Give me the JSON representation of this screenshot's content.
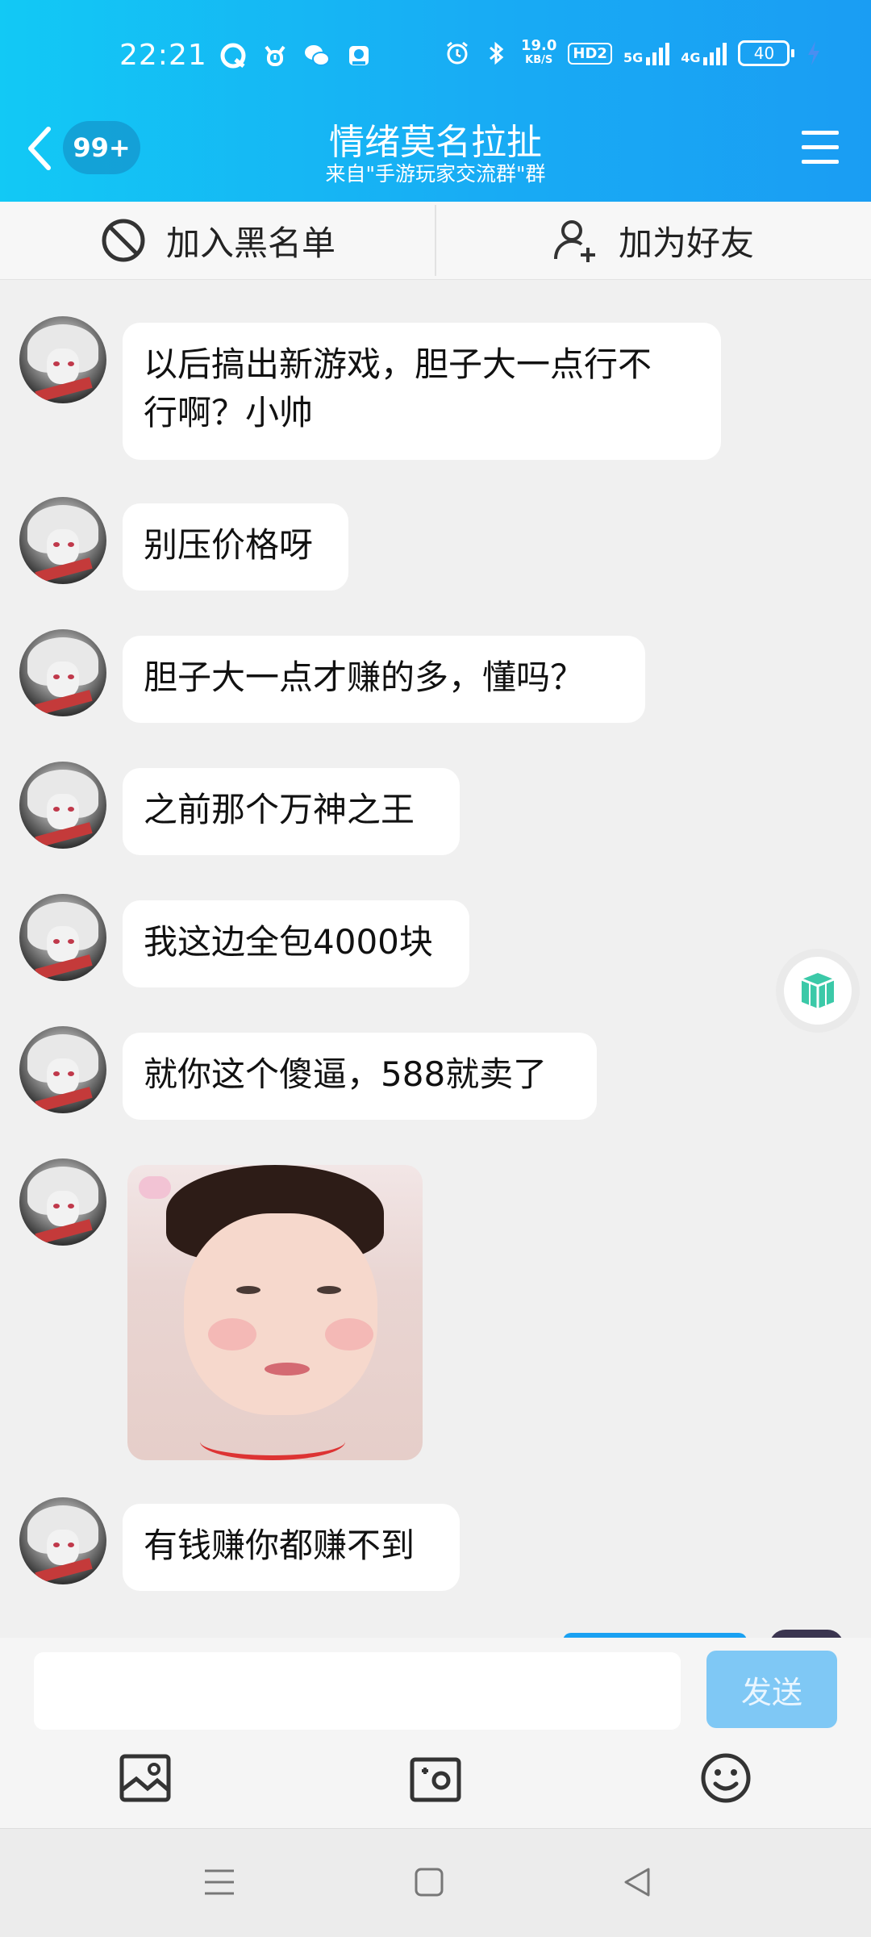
{
  "status_bar": {
    "time": "22:21",
    "net_speed_top": "19.0",
    "net_speed_bottom": "KB/S",
    "hd_badge": "HD2",
    "net1": "5G",
    "net2": "4G",
    "battery": "40"
  },
  "header": {
    "unread_badge": "99+",
    "title": "情绪莫名拉扯",
    "subtitle": "来自\"手游玩家交流群\"群"
  },
  "actions": {
    "block_label": "加入黑名单",
    "add_friend_label": "加为好友"
  },
  "messages": [
    {
      "type": "text",
      "text_line1": "以后搞出新游戏，胆子大一点行不",
      "text_line2": "行啊？小帅"
    },
    {
      "type": "text",
      "text": "别压价格呀"
    },
    {
      "type": "text",
      "text": "胆子大一点才赚的多，懂吗？"
    },
    {
      "type": "text",
      "text": "之前那个万神之王"
    },
    {
      "type": "text",
      "text": "我这边全包4000块"
    },
    {
      "type": "text",
      "text": "就你这个傻逼，588就卖了"
    },
    {
      "type": "image",
      "description": "sticker"
    },
    {
      "type": "text",
      "text": "有钱赚你都赚不到"
    }
  ],
  "input": {
    "value": "",
    "send_label": "发送"
  },
  "colors": {
    "header_start": "#12c9f5",
    "header_end": "#1a9df3",
    "send_button": "#7fc8f5",
    "background": "#f0f0f0"
  },
  "icons": {
    "status_left": [
      "qq-browser-icon",
      "alarm-app-icon",
      "wechat-icon",
      "app-icon"
    ],
    "status_right": [
      "alarm-icon",
      "bluetooth-icon",
      "signal-icon",
      "battery-icon"
    ],
    "tools": [
      "image-icon",
      "camera-icon",
      "emoji-icon"
    ],
    "nav": [
      "menu-icon",
      "home-icon",
      "back-icon"
    ]
  }
}
